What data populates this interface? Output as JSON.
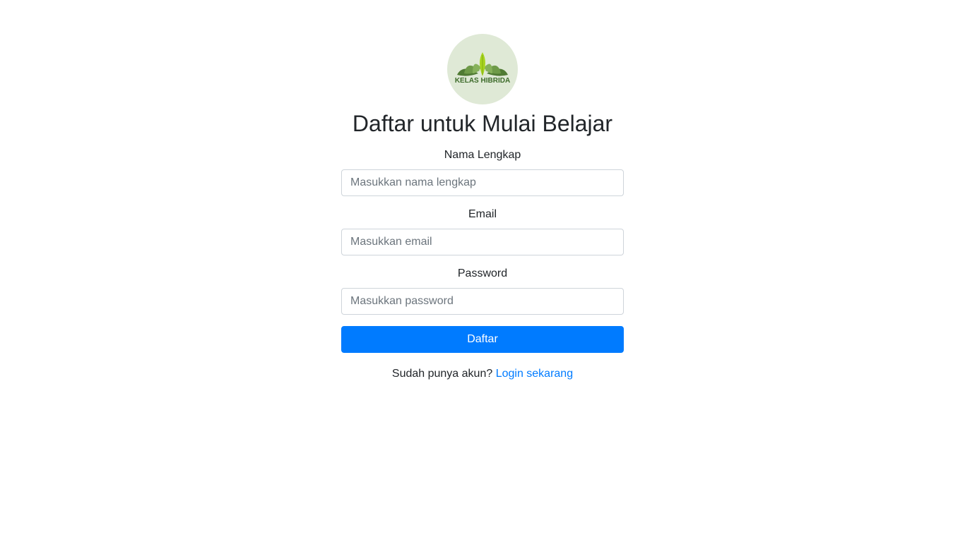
{
  "brand": {
    "logo_text": "KELAS HIBRIDA",
    "logo_bg_color": "#dfe9d6",
    "leaf_colors": [
      "#5f8f3e",
      "#7aa94f",
      "#a6d12a"
    ]
  },
  "page": {
    "title": "Daftar untuk Mulai Belajar"
  },
  "form": {
    "name": {
      "label": "Nama Lengkap",
      "placeholder": "Masukkan nama lengkap",
      "value": ""
    },
    "email": {
      "label": "Email",
      "placeholder": "Masukkan email",
      "value": ""
    },
    "password": {
      "label": "Password",
      "placeholder": "Masukkan password",
      "value": ""
    },
    "submit_label": "Daftar"
  },
  "footer": {
    "prompt": "Sudah punya akun?",
    "login_link": "Login sekarang"
  },
  "colors": {
    "primary": "#007bff",
    "text": "#212529"
  }
}
